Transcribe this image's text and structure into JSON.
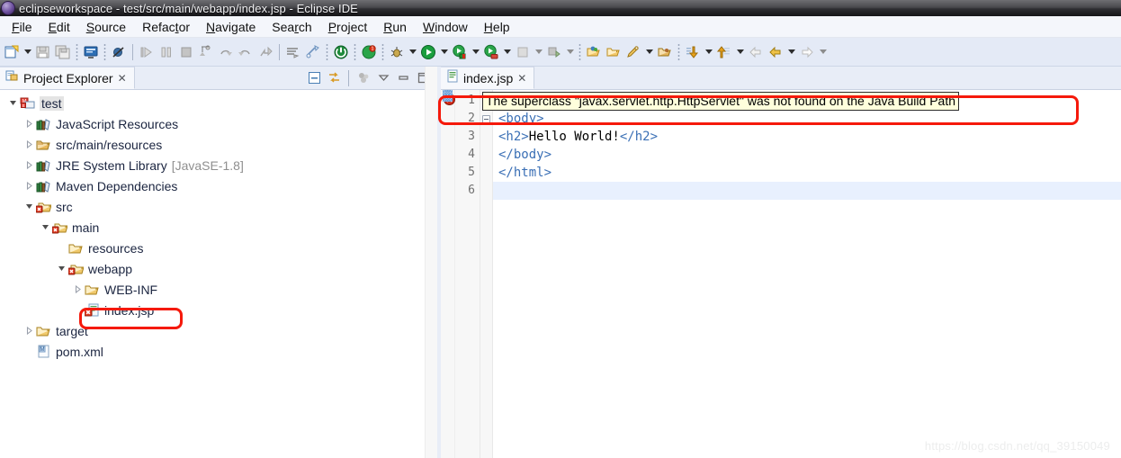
{
  "window": {
    "title": "eclipseworkspace - test/src/main/webapp/index.jsp - Eclipse IDE",
    "logo_icon": "eclipse-logo-icon"
  },
  "menu": {
    "items": [
      {
        "label": "File",
        "mnemonic": "F"
      },
      {
        "label": "Edit",
        "mnemonic": "E"
      },
      {
        "label": "Source",
        "mnemonic": "S"
      },
      {
        "label": "Refactor",
        "mnemonic": "t"
      },
      {
        "label": "Navigate",
        "mnemonic": "N"
      },
      {
        "label": "Search",
        "mnemonic": "r"
      },
      {
        "label": "Project",
        "mnemonic": "P"
      },
      {
        "label": "Run",
        "mnemonic": "R"
      },
      {
        "label": "Window",
        "mnemonic": "W"
      },
      {
        "label": "Help",
        "mnemonic": "H"
      }
    ]
  },
  "toolbar": {
    "icons": [
      "new-file-icon",
      "new-dropdown-arrow",
      "save-icon",
      "save-all-icon",
      "console-icon",
      "skip-breakpoints-icon",
      "resume-icon",
      "suspend-icon",
      "terminate-icon",
      "step-into-icon",
      "step-over-icon",
      "step-return-icon",
      "drop-to-frame-icon",
      "open-task-icon",
      "new-wizard-icon",
      "debug-server-icon",
      "start-server-icon",
      "debug-icon",
      "debug-dropdown-arrow",
      "run-icon",
      "run-dropdown-arrow",
      "run-as-server-icon",
      "run-as-dropdown-arrow",
      "profile-icon",
      "profile-dropdown-arrow",
      "stop-icon",
      "stop-dropdown-arrow",
      "external-tools-icon",
      "external-tools-dropdown-arrow",
      "open-type-icon",
      "open-resource-icon",
      "search-icon",
      "search-dropdown-arrow",
      "open-task-2-icon",
      "next-annotation-icon",
      "next-dropdown-arrow",
      "previous-annotation-icon",
      "previous-dropdown-arrow",
      "back-disabled-icon",
      "back-icon",
      "back-dropdown-arrow",
      "forward-icon",
      "forward-dropdown-arrow"
    ]
  },
  "explorer": {
    "tab_label": "Project Explorer",
    "tab_icon": "project-explorer-icon",
    "close_label": "✕",
    "tools": [
      "collapse-all-icon",
      "link-with-editor-icon",
      "focus-on-active-task-icon",
      "view-menu-icon",
      "minimize-icon",
      "maximize-icon"
    ],
    "tree": [
      {
        "label": "test",
        "icon": "maven-project-icon",
        "indent": 0,
        "state": "expanded",
        "selected": true,
        "sub": ""
      },
      {
        "label": "JavaScript Resources",
        "icon": "library-icon",
        "indent": 1,
        "state": "collapsed",
        "selected": false,
        "sub": ""
      },
      {
        "label": "src/main/resources",
        "icon": "source-folder-icon",
        "indent": 1,
        "state": "collapsed",
        "selected": false,
        "sub": ""
      },
      {
        "label": "JRE System Library",
        "icon": "library-icon",
        "indent": 1,
        "state": "collapsed",
        "selected": false,
        "sub": "[JavaSE-1.8]"
      },
      {
        "label": "Maven Dependencies",
        "icon": "library-icon",
        "indent": 1,
        "state": "collapsed",
        "selected": false,
        "sub": ""
      },
      {
        "label": "src",
        "icon": "folder-error-icon",
        "indent": 1,
        "state": "expanded",
        "selected": false,
        "sub": ""
      },
      {
        "label": "main",
        "icon": "folder-error-icon",
        "indent": 2,
        "state": "expanded",
        "selected": false,
        "sub": ""
      },
      {
        "label": "resources",
        "icon": "folder-icon",
        "indent": 3,
        "state": "leaf",
        "selected": false,
        "sub": ""
      },
      {
        "label": "webapp",
        "icon": "folder-error-icon",
        "indent": 3,
        "state": "expanded",
        "selected": false,
        "sub": ""
      },
      {
        "label": "WEB-INF",
        "icon": "folder-icon",
        "indent": 4,
        "state": "collapsed",
        "selected": false,
        "sub": ""
      },
      {
        "label": "index.jsp",
        "icon": "jsp-error-icon",
        "indent": 4,
        "state": "leaf",
        "selected": false,
        "sub": "",
        "annotated": true
      },
      {
        "label": "target",
        "icon": "folder-icon",
        "indent": 1,
        "state": "collapsed",
        "selected": false,
        "sub": ""
      },
      {
        "label": "pom.xml",
        "icon": "maven-xml-icon",
        "indent": 1,
        "state": "leaf",
        "selected": false,
        "sub": ""
      }
    ]
  },
  "editor": {
    "tab_label": "index.jsp",
    "tab_icon": "jsp-file-icon",
    "close_label": "✕",
    "error_marker_icon": "error-marker-icon",
    "tooltip_text": "The superclass \"javax.servlet.http.HttpServlet\" was not found on the Java Build Path",
    "line_numbers": [
      "1",
      "2",
      "3",
      "4",
      "5",
      "6"
    ],
    "lines": [
      {
        "num": "1",
        "fold": true,
        "segments": [],
        "current": false
      },
      {
        "num": "2",
        "fold": true,
        "segments": [
          {
            "t": "<body>",
            "c": "tag"
          }
        ],
        "current": false
      },
      {
        "num": "3",
        "fold": false,
        "segments": [
          {
            "t": "<h2>",
            "c": "tag"
          },
          {
            "t": "Hello World!",
            "c": "txt"
          },
          {
            "t": "</h2>",
            "c": "tag"
          }
        ],
        "current": false
      },
      {
        "num": "4",
        "fold": false,
        "segments": [
          {
            "t": "</body>",
            "c": "tag"
          }
        ],
        "current": false
      },
      {
        "num": "5",
        "fold": false,
        "segments": [
          {
            "t": "</html>",
            "c": "tag"
          }
        ],
        "current": false
      },
      {
        "num": "6",
        "fold": false,
        "segments": [
          {
            "t": "",
            "c": "txt"
          }
        ],
        "current": true
      }
    ]
  },
  "annotations": {
    "tooltip_box": "red-highlight-rect-editor",
    "tree_box": "red-highlight-rect-indexjsp"
  },
  "watermark": {
    "text": "https://blog.csdn.net/qq_39150049"
  },
  "colors": {
    "accent_red": "#f5190b",
    "tooltip_bg": "#ffffdc",
    "toolbar_bg": "#e4eaf6",
    "tab_bg": "#f6f8fc",
    "code_tag": "#3a6fb5",
    "current_line": "#e8f0fe"
  }
}
